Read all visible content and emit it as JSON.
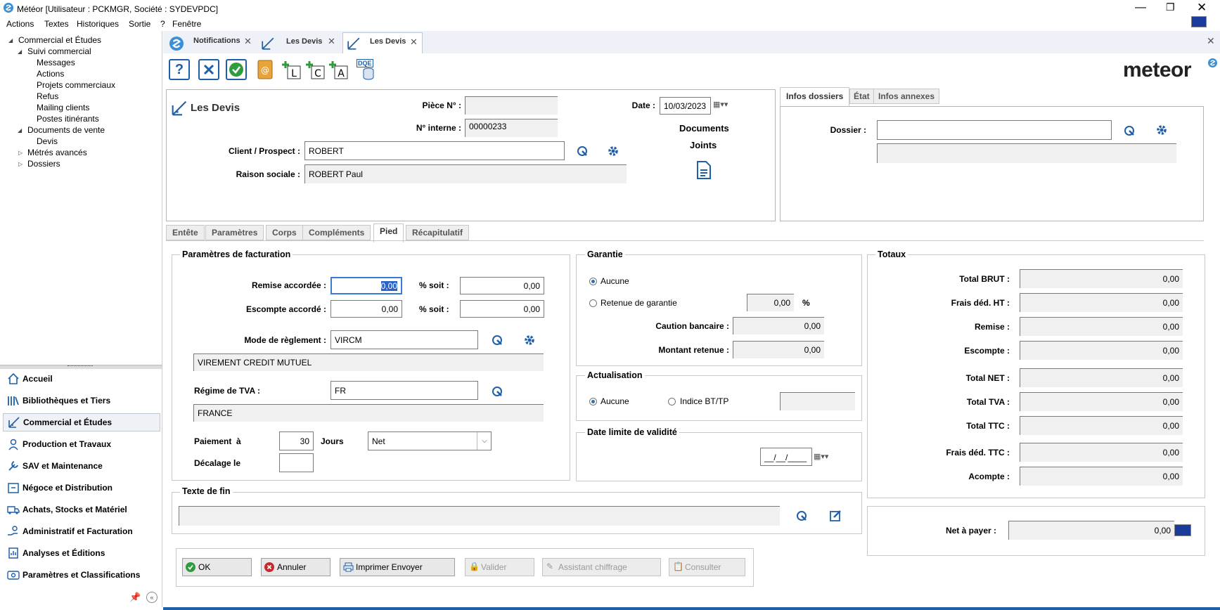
{
  "window": {
    "title": "Météor [Utilisateur : PCKMGR, Société : SYDEVPDC]"
  },
  "menu": [
    "Actions",
    "Textes",
    "Historiques",
    "Sortie",
    "?",
    "Fenêtre"
  ],
  "tree": [
    {
      "label": "Commercial et Études",
      "level": 0
    },
    {
      "label": "Suivi commercial",
      "level": 1
    },
    {
      "label": "Messages",
      "level": 2
    },
    {
      "label": "Actions",
      "level": 2
    },
    {
      "label": "Projets commerciaux",
      "level": 2
    },
    {
      "label": "Refus",
      "level": 2
    },
    {
      "label": "Mailing clients",
      "level": 2
    },
    {
      "label": "Postes itinérants",
      "level": 2
    },
    {
      "label": "Documents de vente",
      "level": 1
    },
    {
      "label": "Devis",
      "level": 2
    },
    {
      "label": "Métrés avancés",
      "level": 1
    },
    {
      "label": "Dossiers",
      "level": 1
    }
  ],
  "nav": [
    "Accueil",
    "Bibliothèques et Tiers",
    "Commercial et Études",
    "Production et Travaux",
    "SAV et Maintenance",
    "Négoce et Distribution",
    "Achats, Stocks et Matériel",
    "Administratif et Facturation",
    "Analyses et Éditions",
    "Paramètres et Classifications"
  ],
  "doc_tabs": [
    "Notifications",
    "Les Devis",
    "Les Devis"
  ],
  "toolbar": {
    "help": "?",
    "dqe": "DQE",
    "logo": "meteor"
  },
  "header": {
    "title": "Les Devis",
    "piece_label": "Pièce N° :",
    "piece_value": "",
    "interne_label": "N° interne :",
    "interne_value": "00000233",
    "date_label": "Date :",
    "date_value": "10/03/2023",
    "client_label": "Client / Prospect :",
    "client_value": "ROBERT",
    "raison_label": "Raison sociale :",
    "raison_value": "ROBERT Paul",
    "docs_label": "Documents",
    "joints_label": "Joints"
  },
  "right_tabs": [
    "Infos dossiers",
    "État",
    "Infos annexes"
  ],
  "dossier": {
    "label": "Dossier :",
    "value": ""
  },
  "main_tabs": [
    "Entête",
    "Paramètres",
    "Corps",
    "Compléments",
    "Pied",
    "Récapitulatif"
  ],
  "facturation": {
    "title": "Paramètres de facturation",
    "remise_label": "Remise accordée :",
    "remise_value": "0,00",
    "escompte_label": "Escompte accordé :",
    "escompte_value": "0,00",
    "pct_soit": "% soit :",
    "remise_soit": "0,00",
    "escompte_soit": "0,00",
    "mode_label": "Mode de règlement :",
    "mode_value": "VIRCM",
    "mode_desc": "VIREMENT CREDIT MUTUEL",
    "tva_label": "Régime de TVA :",
    "tva_value": "FR",
    "tva_desc": "FRANCE",
    "paiement_label": "Paiement  à",
    "paiement_value": "30",
    "jours_label": "Jours",
    "net_value": "Net",
    "decalage_label": "Décalage le",
    "decalage_value": ""
  },
  "garantie": {
    "title": "Garantie",
    "aucune": "Aucune",
    "retenue": "Retenue de garantie",
    "retenue_value": "0,00",
    "pct": "%",
    "caution_label": "Caution bancaire :",
    "caution_value": "0,00",
    "montant_label": "Montant retenue :",
    "montant_value": "0,00"
  },
  "actualisation": {
    "title": "Actualisation",
    "aucune": "Aucune",
    "indice": "Indice BT/TP",
    "indice_value": ""
  },
  "validite": {
    "title": "Date limite de validité",
    "value": "__/__/____"
  },
  "texte_fin": {
    "title": "Texte de fin",
    "value": ""
  },
  "totaux": {
    "title": "Totaux",
    "rows": [
      {
        "label": "Total BRUT :",
        "value": "0,00"
      },
      {
        "label": "Frais déd. HT :",
        "value": "0,00"
      },
      {
        "label": "Remise :",
        "value": "0,00"
      },
      {
        "label": "Escompte :",
        "value": "0,00"
      },
      {
        "label": "Total NET :",
        "value": "0,00"
      },
      {
        "label": "Total TVA :",
        "value": "0,00"
      },
      {
        "label": "Total TTC :",
        "value": "0,00"
      },
      {
        "label": "Frais déd. TTC :",
        "value": "0,00"
      },
      {
        "label": "Acompte :",
        "value": "0,00"
      }
    ],
    "net_label": "Net à payer :",
    "net_value": "0,00"
  },
  "buttons": [
    "OK",
    "Annuler",
    "Imprimer Envoyer",
    "Valider",
    "Assistant chiffrage",
    "Consulter"
  ],
  "colors": {
    "accent": "#1f5fa8",
    "ok": "#2e9b3c",
    "cancel": "#c42b2b",
    "eu": "#1a3a9c"
  }
}
